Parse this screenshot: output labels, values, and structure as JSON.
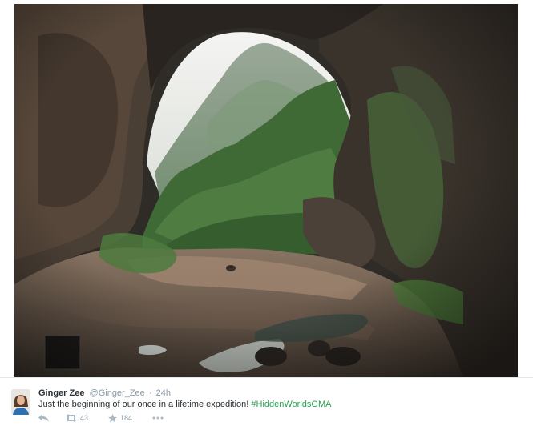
{
  "tweet": {
    "display_name": "Ginger Zee",
    "handle": "@Ginger_Zee",
    "separator": "·",
    "time": "24h",
    "text": "Just the beginning of our once in a lifetime expedition! ",
    "hashtag": "#HiddenWorldsGMA",
    "retweet_count": "43",
    "favorite_count": "184"
  },
  "icons": {
    "reply": "reply-icon",
    "retweet": "retweet-icon",
    "favorite": "star-icon",
    "more": "more-icon"
  },
  "colors": {
    "hashtag": "#2b9f4f",
    "meta": "#8899a6",
    "text": "#292f33"
  }
}
